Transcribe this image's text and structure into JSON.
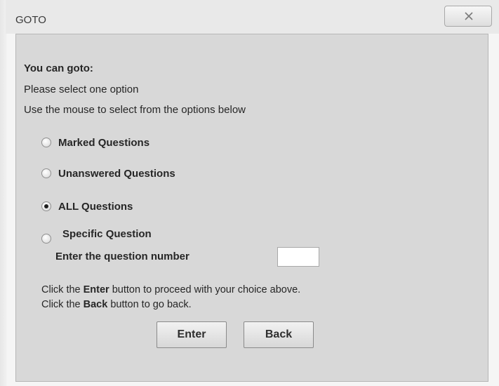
{
  "window": {
    "title": "GOTO",
    "close_icon": "close-icon"
  },
  "heading": "You can goto:",
  "instructions": [
    "Please select one option",
    "Use the mouse to select from the options below"
  ],
  "options": [
    {
      "label": "Marked Questions",
      "checked": false
    },
    {
      "label": "Unanswered Questions",
      "checked": false
    },
    {
      "label": "ALL Questions",
      "checked": true
    },
    {
      "label": "Specific Question",
      "checked": false
    }
  ],
  "question_number": {
    "label": "Enter the question number",
    "value": ""
  },
  "help": {
    "line1_prefix": "Click the ",
    "line1_bold": "Enter",
    "line1_suffix": " button to proceed with your choice above.",
    "line2_prefix": "Click the ",
    "line2_bold": "Back",
    "line2_suffix": " button to go back."
  },
  "buttons": {
    "enter": "Enter",
    "back": "Back"
  }
}
